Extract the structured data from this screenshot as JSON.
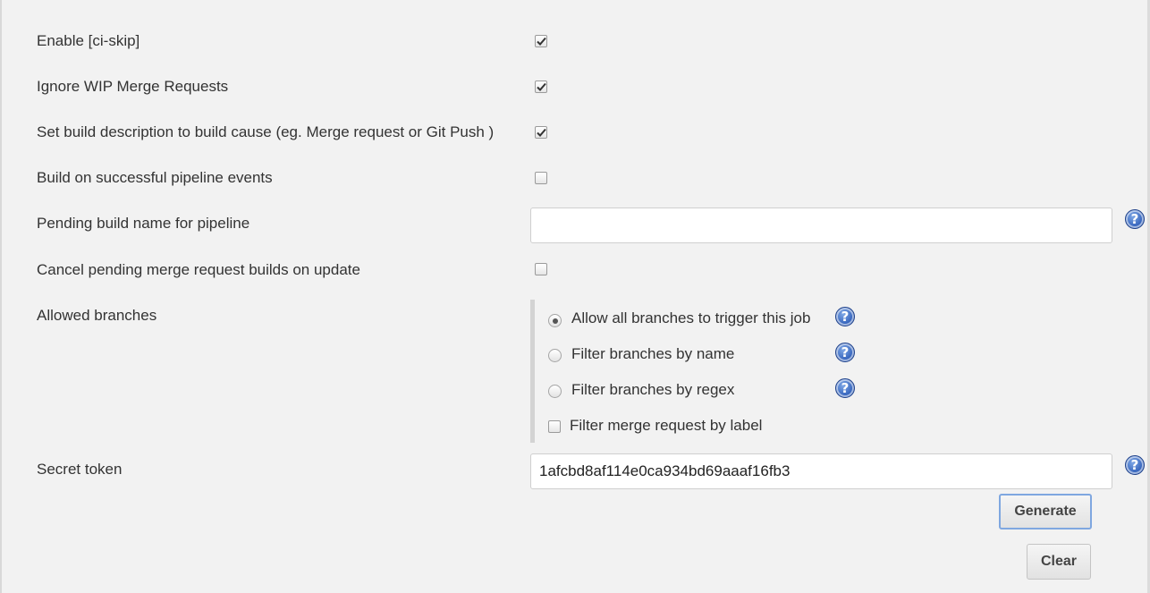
{
  "options": {
    "ci_skip": {
      "label": "Enable [ci-skip]",
      "checked": true
    },
    "ignore_wip": {
      "label": "Ignore WIP Merge Requests",
      "checked": true
    },
    "build_description": {
      "label": "Set build description to build cause (eg. Merge request or Git Push )",
      "checked": true
    },
    "pipeline_events": {
      "label": "Build on successful pipeline events",
      "checked": false
    },
    "pending_build_name": {
      "label": "Pending build name for pipeline",
      "value": ""
    },
    "cancel_pending": {
      "label": "Cancel pending merge request builds on update",
      "checked": false
    }
  },
  "allowed_branches": {
    "label": "Allowed branches",
    "choices": [
      {
        "label": "Allow all branches to trigger this job",
        "selected": true
      },
      {
        "label": "Filter branches by name",
        "selected": false
      },
      {
        "label": "Filter branches by regex",
        "selected": false
      }
    ],
    "label_filter": {
      "label": "Filter merge request by label",
      "checked": false
    }
  },
  "secret_token": {
    "label": "Secret token",
    "value": "1afcbd8af114e0ca934bd69aaaf16fb3"
  },
  "buttons": {
    "generate": "Generate",
    "clear": "Clear"
  },
  "help_glyph": "?",
  "icons": {
    "help": "help-icon",
    "check": "checkmark-icon"
  }
}
